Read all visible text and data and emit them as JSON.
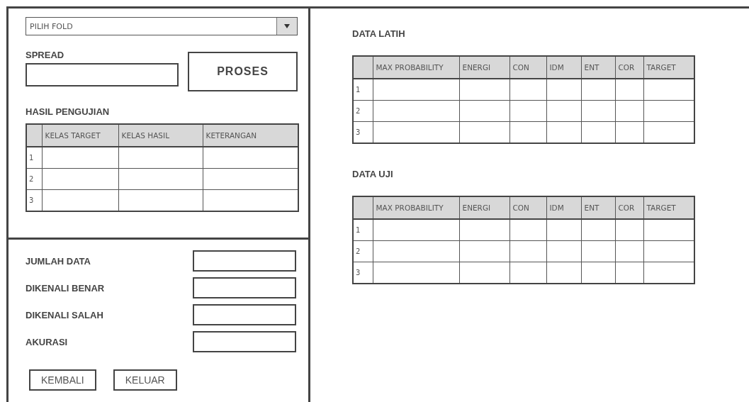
{
  "fold_select": {
    "value": "PILIH FOLD"
  },
  "spread": {
    "label": "SPREAD"
  },
  "process_button": "PROSES",
  "results": {
    "title": "HASIL PENGUJIAN",
    "columns": [
      "KELAS TARGET",
      "KELAS HASIL",
      "KETERANGAN"
    ],
    "rows": [
      "1",
      "2",
      "3"
    ]
  },
  "summary": [
    {
      "label": "JUMLAH DATA"
    },
    {
      "label": "DIKENALI BENAR"
    },
    {
      "label": "DIKENALI SALAH"
    },
    {
      "label": "AKURASI"
    }
  ],
  "buttons": [
    "KEMBALI",
    "KELUAR"
  ],
  "data_tables": [
    {
      "title": "DATA LATIH",
      "columns": [
        "MAX PROBABILITY",
        "ENERGI",
        "CON",
        "IDM",
        "ENT",
        "COR",
        "TARGET"
      ],
      "rows": [
        "1",
        "2",
        "3"
      ]
    },
    {
      "title": "DATA UJI",
      "columns": [
        "MAX PROBABILITY",
        "ENERGI",
        "CON",
        "IDM",
        "ENT",
        "COR",
        "TARGET"
      ],
      "rows": [
        "1",
        "2",
        "3"
      ]
    }
  ]
}
